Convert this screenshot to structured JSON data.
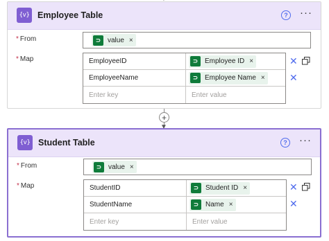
{
  "cards": [
    {
      "title": "Employee Table",
      "header_icon": "{v}",
      "from_label": "From",
      "from_token": "value",
      "map_label": "Map",
      "rows": [
        {
          "key": "EmployeeID",
          "value": "Employee ID"
        },
        {
          "key": "EmployeeName",
          "value": "Employee Name"
        }
      ],
      "key_placeholder": "Enter key",
      "value_placeholder": "Enter value"
    },
    {
      "title": "Student Table",
      "header_icon": "{v}",
      "from_label": "From",
      "from_token": "value",
      "map_label": "Map",
      "rows": [
        {
          "key": "StudentID",
          "value": "Student ID"
        },
        {
          "key": "StudentName",
          "value": "Name"
        }
      ],
      "key_placeholder": "Enter key",
      "value_placeholder": "Enter value"
    }
  ],
  "icons": {
    "header": "variable-icon",
    "help": "help-icon",
    "more": "more-icon",
    "token": "dataverse-icon",
    "delete": "close-icon",
    "copy": "copy-icon",
    "add": "plus-icon",
    "arrow": "arrow-down-icon"
  },
  "glyphs": {
    "required": "*",
    "help": "?",
    "more": "···",
    "remove": "×",
    "delete": "✕",
    "add": "+",
    "arrow": "▼"
  },
  "colors": {
    "header_bg": "#ece4fa",
    "icon_purple": "#7f5ed2",
    "selected_border": "#8a6fd1",
    "token_bg": "#e8f3ec",
    "token_icon": "#0f7b3a",
    "accent_blue": "#4f6bed",
    "required_red": "#c4314b"
  }
}
